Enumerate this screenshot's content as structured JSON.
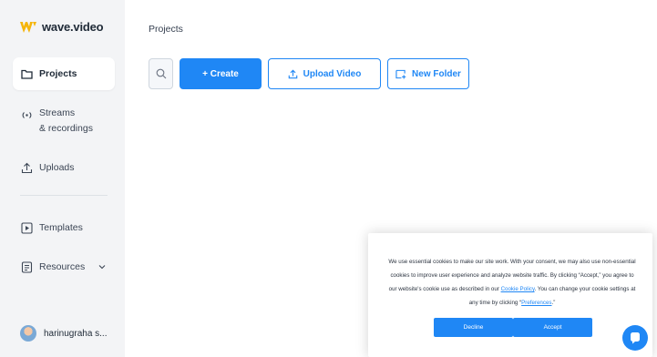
{
  "app": {
    "name": "wave.video",
    "brand_color": "#f5b50a",
    "accent_color": "#1f87f5"
  },
  "sidebar": {
    "items": [
      {
        "label": "Projects",
        "icon": "folder-icon",
        "active": true
      },
      {
        "label": "Streams\n& recordings",
        "icon": "broadcast-icon",
        "active": false
      },
      {
        "label": "Uploads",
        "icon": "upload-icon",
        "active": false
      },
      {
        "label": "Templates",
        "icon": "template-icon",
        "active": false
      },
      {
        "label": "Resources",
        "icon": "resources-icon",
        "active": false,
        "has_dropdown": true
      }
    ],
    "user": {
      "name": "harinugraha s..."
    }
  },
  "main": {
    "breadcrumb": "Projects",
    "toolbar": {
      "create_label": "+ Create",
      "upload_label": "Upload Video",
      "new_folder_label": "New Folder"
    }
  },
  "cookie_banner": {
    "text_1": "We use essential cookies to make our site work. With your consent, we may also use non-essential cookies to improve user experience and analyze website traffic. By clicking “Accept,” you agree to our website's cookie use as described in our ",
    "link_policy": "Cookie Policy",
    "text_2": ". You can change your cookie settings at any time by clicking “",
    "link_preferences": "Preferences",
    "text_3": ".”",
    "decline_label": "Decline",
    "accept_label": "Accept"
  }
}
